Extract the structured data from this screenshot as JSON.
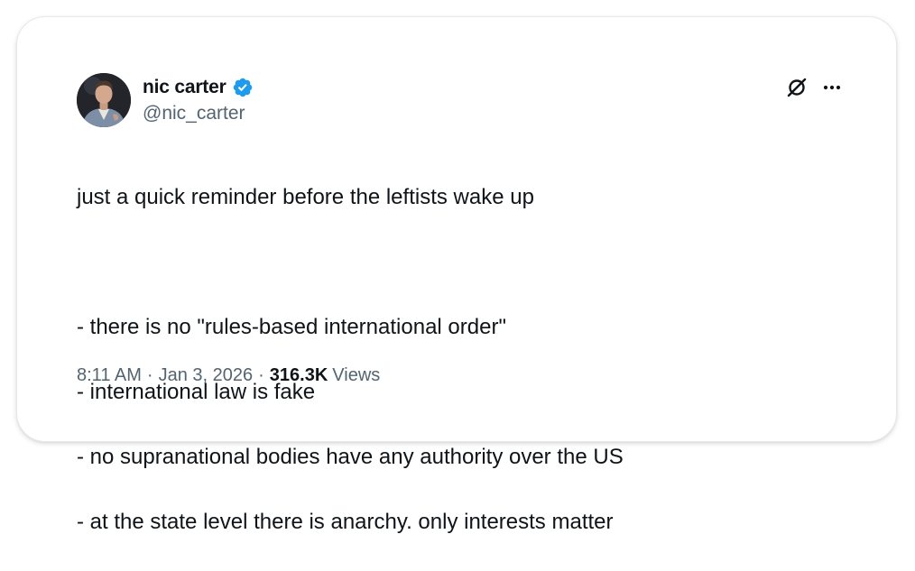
{
  "author": {
    "display_name": "nic carter",
    "handle": "@nic_carter",
    "verified": true,
    "avatar_icon": "profile-photo"
  },
  "header_icons": {
    "logo": "x-logo-icon",
    "menu": "more-options-icon"
  },
  "tweet": {
    "lines": [
      "just a quick reminder before the leftists wake up",
      "",
      "- there is no \"rules-based international order\"",
      "- international law is fake",
      "- no supranational bodies have any authority over the US",
      "- at the state level there is anarchy. only interests matter"
    ]
  },
  "meta": {
    "time": "8:11 AM",
    "separator": "·",
    "date": "Jan 3, 2026",
    "views_count": "316.3K",
    "views_label": "Views"
  },
  "colors": {
    "verified_badge": "#1d9bf0",
    "text_primary": "#0f1419",
    "text_secondary": "#536471"
  }
}
